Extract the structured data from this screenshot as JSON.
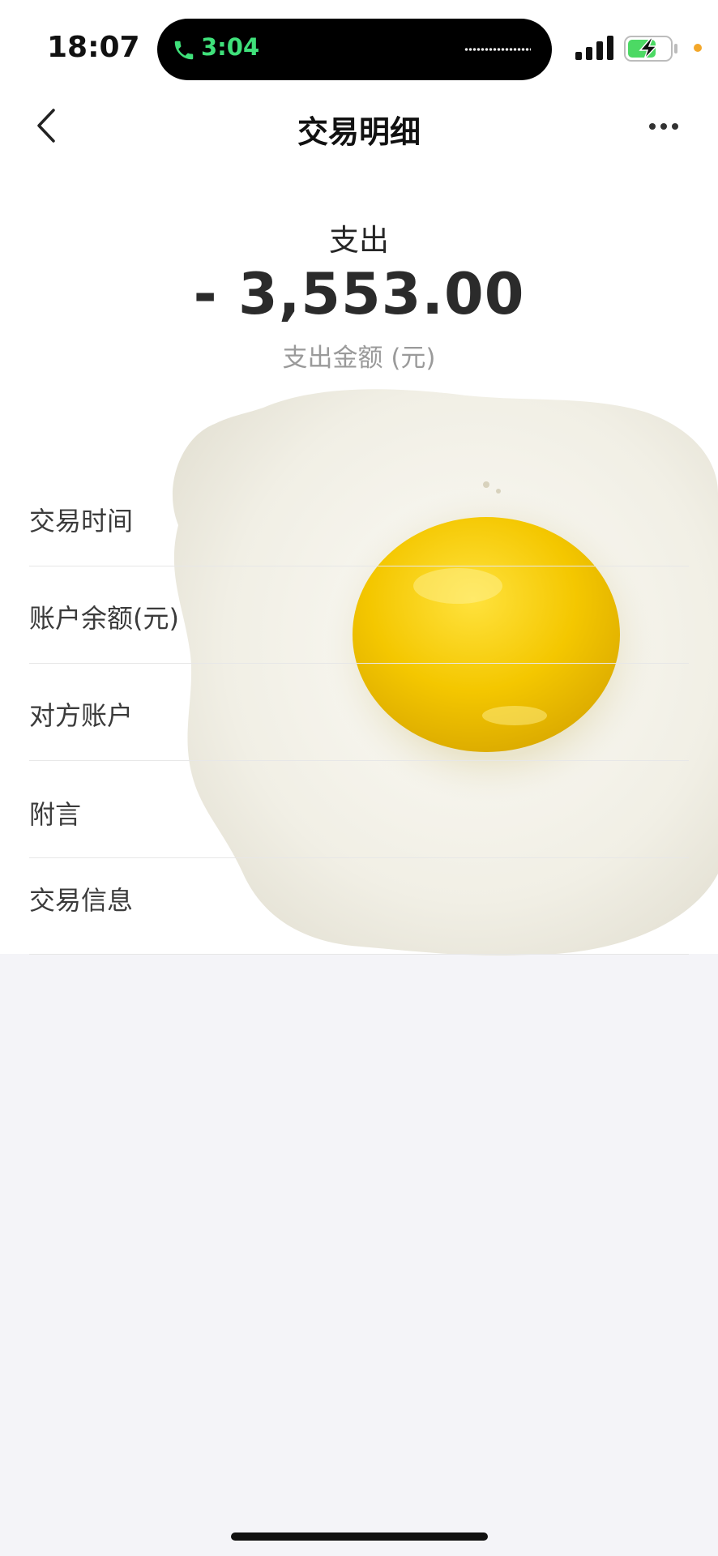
{
  "status_bar": {
    "time": "18:07",
    "call_timer": "3:04"
  },
  "nav": {
    "title": "交易明细"
  },
  "summary": {
    "type_label": "支出",
    "amount": "- 3,553.00",
    "caption": "支出金额 (元)"
  },
  "details": [
    {
      "label": "交易时间"
    },
    {
      "label": "账户余额(元)"
    },
    {
      "label": "对方账户"
    },
    {
      "label": "附言"
    },
    {
      "label": "交易信息"
    }
  ],
  "colors": {
    "call_green": "#3fe07a",
    "battery_green": "#4cd964",
    "indicator_orange": "#f3a72a",
    "egg_yolk": "#f2c500"
  }
}
